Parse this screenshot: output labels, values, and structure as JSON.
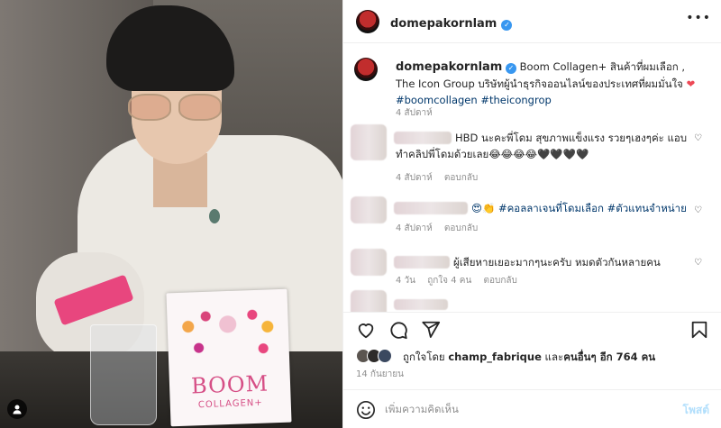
{
  "post": {
    "username": "domepakornlam",
    "caption": {
      "username": "domepakornlam",
      "text": "Boom Collagen+ สินค้าที่ผมเลือก , The Icon Group บริษัทผู้นำธุรกิจออนไลน์ของประเทศที่ผมมั่นใจ",
      "heart": "❤",
      "hashtags": "#boomcollagen #theicongrop",
      "time": "4 สัปดาห์"
    },
    "comments": [
      {
        "text": "HBD นะคะพี่โดม สุขภาพแข็งแรง รวยๆเฮงๆค่ะ แอบทำคลิปพี่โดมด้วยเลย😂😂😂😂🖤🖤🖤🖤",
        "time": "4 สัปดาห์",
        "reply": "ตอบกลับ"
      },
      {
        "text": "😍👏 #คอลลาเจนที่โดมเลือก #ตัวแทนจำหน่าย",
        "time": "4 สัปดาห์",
        "reply": "ตอบกลับ"
      },
      {
        "text": "ผู้เสียหายเยอะมากๆนะครับ หมดตัวกันหลายคน",
        "time": "4 วัน",
        "likes": "ถูกใจ 4 คน",
        "reply": "ตอบกลับ"
      }
    ],
    "liked_by": {
      "prefix": "ถูกใจโดย",
      "user": "champ_fabrique",
      "middle": "และ",
      "others": "คนอื่นๆ อีก 764 คน"
    },
    "date": "14 กันยายน",
    "add_comment": {
      "placeholder": "เพิ่มความคิดเห็น",
      "post_label": "โพสต์"
    },
    "photo": {
      "box_brand": "BOOM",
      "box_sub": "COLLAGEN+"
    },
    "icons": {
      "like": "heart-outline-icon",
      "comment": "speech-bubble-icon",
      "share": "paper-plane-icon",
      "save": "bookmark-icon",
      "more": "ellipsis-icon",
      "verified": "verified-badge-icon",
      "emoji": "smiley-icon",
      "tags": "person-tag-icon"
    },
    "colors": {
      "verified": "#3897f0",
      "hashtag": "#00376b",
      "heart": "#ed4956",
      "post_button": "#b2dffc"
    }
  }
}
